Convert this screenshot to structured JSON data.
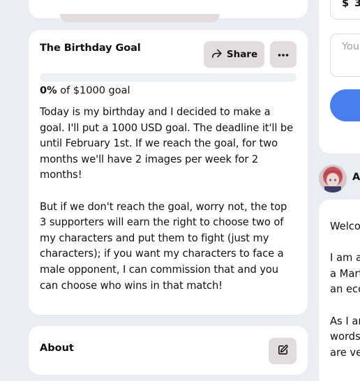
{
  "goal": {
    "title": "The Birthday Goal",
    "share_label": "Share",
    "progress_fraction": 0.0,
    "percent": "0%",
    "goal_text": " of $1000 goal",
    "description": "Today is my birthday and I decided to make a goal. I'll put a 1000 USD goal. The deadline it'll be until February 1st. If we reach the goal, for two months we'll have 2 images per week for 2 months!\n\nBut if we don't reach the goal, worry not, the top 3 supporters will earn the right to choose two of my characters and put them to fight (just my characters); if you want my characters to face a male opponent, I can commission that and you can choose who wins in that match!"
  },
  "about": {
    "title": "About"
  },
  "support": {
    "currency": "$",
    "amount": "3",
    "message_placeholder": "You"
  },
  "creator": {
    "name": "A",
    "bio": "Welco\n\nI am a\na Mart\nan eco\n\nAs I ar\nwords\nare ve"
  },
  "colors": {
    "accent": "#4a7dee",
    "button_bg": "#e3dcde",
    "page_bg": "#eaedf3"
  },
  "icons": {
    "share": "share-arrow-icon",
    "more": "more-horizontal-icon",
    "edit": "edit-icon"
  }
}
